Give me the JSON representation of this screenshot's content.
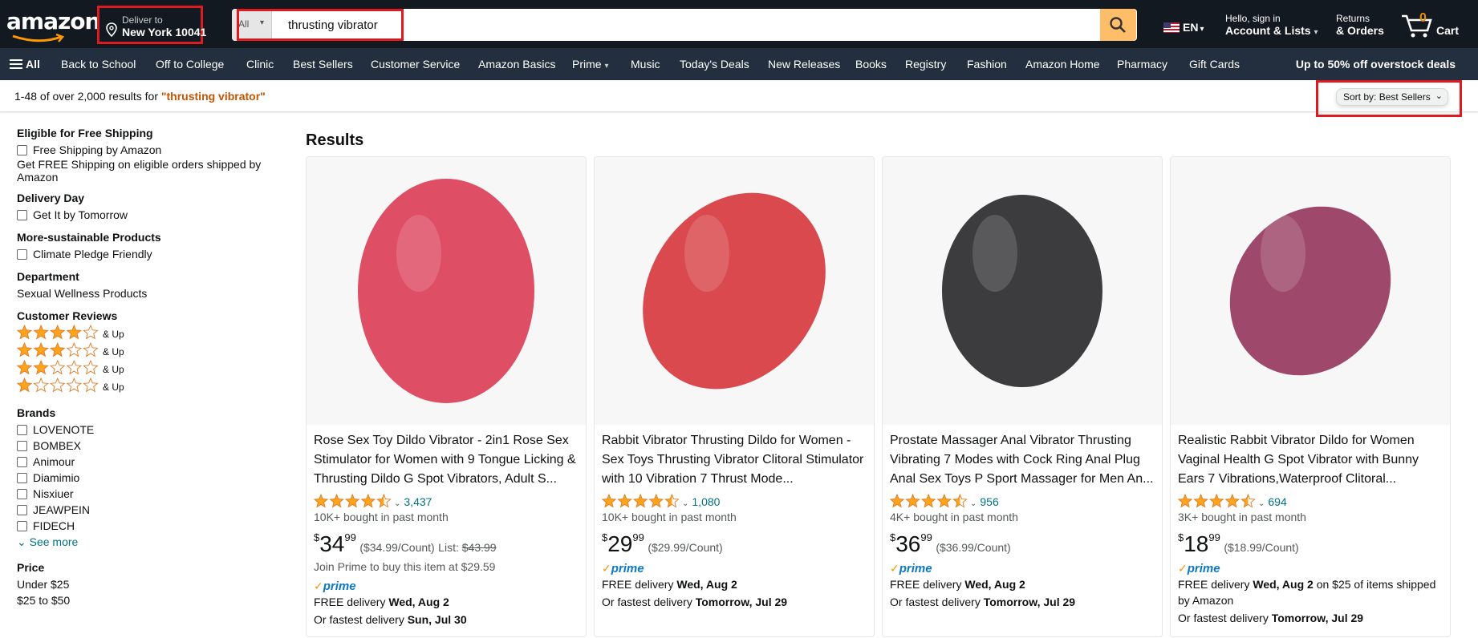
{
  "header": {
    "logo": "amazon",
    "deliver_to_label": "Deliver to",
    "deliver_to_location": "New York 10041",
    "search_dept": "All",
    "search_value": "thrusting vibrator",
    "language": "EN",
    "account_line1": "Hello, sign in",
    "account_line2": "Account & Lists",
    "returns_line1": "Returns",
    "returns_line2": "& Orders",
    "cart_count": "0",
    "cart_label": "Cart"
  },
  "nav": {
    "all_label": "All",
    "items": [
      "Back to School",
      "Off to College",
      "Clinic",
      "Best Sellers",
      "Customer Service",
      "Amazon Basics",
      "Prime",
      "Music",
      "Today's Deals",
      "New Releases",
      "Books",
      "Registry",
      "Fashion",
      "Amazon Home",
      "Pharmacy",
      "Gift Cards"
    ],
    "promo": "Up to 50% off overstock deals"
  },
  "results_bar": {
    "count_text": "1-48 of over 2,000 results for ",
    "query": "\"thrusting vibrator\"",
    "sort_label": "Sort by:",
    "sort_value": "Best Sellers"
  },
  "sidebar": {
    "free_shipping_heading": "Eligible for Free Shipping",
    "free_shipping_option": "Free Shipping by Amazon",
    "free_shipping_note": "Get FREE Shipping on eligible orders shipped by Amazon",
    "delivery_heading": "Delivery Day",
    "delivery_option": "Get It by Tomorrow",
    "sustainable_heading": "More-sustainable Products",
    "sustainable_option": "Climate Pledge Friendly",
    "department_heading": "Department",
    "department_item": "Sexual Wellness Products",
    "reviews_heading": "Customer Reviews",
    "reviews": [
      {
        "stars": 4,
        "label": "& Up"
      },
      {
        "stars": 3,
        "label": "& Up"
      },
      {
        "stars": 2,
        "label": "& Up"
      },
      {
        "stars": 1,
        "label": "& Up"
      }
    ],
    "brands_heading": "Brands",
    "brands": [
      "LOVENOTE",
      "BOMBEX",
      "Animour",
      "Diamimio",
      "Nisxiuer",
      "JEAWPEIN",
      "FIDECH"
    ],
    "see_more": "See more",
    "price_heading": "Price",
    "price_items": [
      "Under $25",
      "$25 to $50"
    ]
  },
  "results": {
    "heading": "Results",
    "products": [
      {
        "title": "Rose Sex Toy Dildo Vibrator - 2in1 Rose Sex Stimulator for Women with 9 Tongue Licking & Thrusting Dildo G Spot Vibrators, Adult S...",
        "rating": 4.5,
        "reviews": "3,437",
        "bought": "10K+ bought in past month",
        "price_whole": "34",
        "price_frac": "99",
        "unit": "($34.99/Count)",
        "list_label": "List:",
        "list_price": "$43.99",
        "prime_note": "Join Prime to buy this item at $29.59",
        "delivery_prefix": "FREE delivery ",
        "delivery_date": "Wed, Aug 2",
        "delivery_suffix": "",
        "fastest_prefix": "Or fastest delivery ",
        "fastest_date": "Sun, Jul 30",
        "image_color": "#d9304a"
      },
      {
        "title": "Rabbit Vibrator Thrusting Dildo for Women - Sex Toys Thrusting Vibrator Clitoral Stimulator with 10 Vibration 7 Thrust Mode...",
        "rating": 4.5,
        "reviews": "1,080",
        "bought": "10K+ bought in past month",
        "price_whole": "29",
        "price_frac": "99",
        "unit": "($29.99/Count)",
        "list_label": "",
        "list_price": "",
        "prime_note": "",
        "delivery_prefix": "FREE delivery ",
        "delivery_date": "Wed, Aug 2",
        "delivery_suffix": "",
        "fastest_prefix": "Or fastest delivery ",
        "fastest_date": "Tomorrow, Jul 29",
        "image_color": "#d32a30"
      },
      {
        "title": "Prostate Massager Anal Vibrator Thrusting Vibrating 7 Modes with Cock Ring Anal Plug Anal Sex Toys P Sport Massager for Men An...",
        "rating": 4.5,
        "reviews": "956",
        "bought": "4K+ bought in past month",
        "price_whole": "36",
        "price_frac": "99",
        "unit": "($36.99/Count)",
        "list_label": "",
        "list_price": "",
        "prime_note": "",
        "delivery_prefix": "FREE delivery ",
        "delivery_date": "Wed, Aug 2",
        "delivery_suffix": "",
        "fastest_prefix": "Or fastest delivery ",
        "fastest_date": "Tomorrow, Jul 29",
        "image_color": "#1b1b1f"
      },
      {
        "title": "Realistic Rabbit Vibrator Dildo for Women Vaginal Health G Spot Vibrator with Bunny Ears 7 Vibrations,Waterproof Clitoral...",
        "rating": 4.5,
        "reviews": "694",
        "bought": "3K+ bought in past month",
        "price_whole": "18",
        "price_frac": "99",
        "unit": "($18.99/Count)",
        "list_label": "",
        "list_price": "",
        "prime_note": "",
        "delivery_prefix": "FREE delivery ",
        "delivery_date": "Wed, Aug 2",
        "delivery_suffix": " on $25 of items shipped by Amazon",
        "fastest_prefix": "Or fastest delivery ",
        "fastest_date": "Tomorrow, Jul 29",
        "image_color": "#8e2a52"
      }
    ]
  },
  "colors": {
    "nav_top": "#131921",
    "nav_main": "#232f3e",
    "search_button": "#febd69",
    "link": "#007185",
    "star": "#ffa41c",
    "query_highlight": "#c45500",
    "annotation_box": "#e0191e"
  }
}
